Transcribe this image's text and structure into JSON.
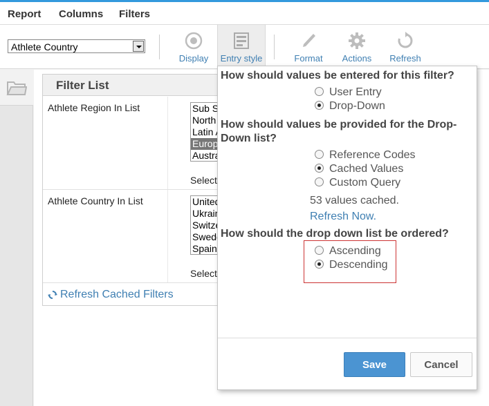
{
  "menu": {
    "items": [
      "Report",
      "Columns",
      "Filters"
    ]
  },
  "toolbar": {
    "field_select_value": "Athlete Country",
    "buttons": [
      {
        "label": "Display",
        "icon": "eye-icon"
      },
      {
        "label": "Entry style",
        "icon": "form-icon"
      },
      {
        "label": "Format",
        "icon": "pencil-icon"
      },
      {
        "label": "Actions",
        "icon": "gear-icon"
      },
      {
        "label": "Refresh",
        "icon": "refresh-icon"
      }
    ]
  },
  "filter_list": {
    "title": "Filter List",
    "rows": [
      {
        "name": "Athlete Region In List",
        "options": [
          "Sub S",
          "North",
          "Latin A",
          "Europ",
          "Austra"
        ],
        "selected_index": 3,
        "select_label": "Select"
      },
      {
        "name": "Athlete Country In List",
        "options": [
          "United",
          "Ukrain",
          "Switze",
          "Swede",
          "Spain"
        ],
        "selected_index": -1,
        "select_label": "Select"
      }
    ],
    "refresh_label": "Refresh Cached Filters"
  },
  "popup": {
    "q1": "How should values be entered for this filter?",
    "q1_options": [
      {
        "label": "User Entry",
        "checked": false
      },
      {
        "label": "Drop-Down",
        "checked": true
      }
    ],
    "q2_line1": "How should values be provided for the Drop-",
    "q2_line2": "Down list?",
    "q2_options": [
      {
        "label": "Reference Codes",
        "checked": false
      },
      {
        "label": "Cached Values",
        "checked": true
      },
      {
        "label": "Custom Query",
        "checked": false
      }
    ],
    "cached_note": "53 values cached.",
    "refresh_now": "Refresh Now.",
    "q3": "How should the drop down list be ordered?",
    "q3_options": [
      {
        "label": "Ascending",
        "checked": false
      },
      {
        "label": "Descending",
        "checked": true
      }
    ],
    "save_label": "Save",
    "cancel_label": "Cancel"
  },
  "colors": {
    "accent": "#3399dd",
    "link": "#3f7fb2",
    "save_button": "#4b94d2",
    "highlight": "#cc3333"
  }
}
